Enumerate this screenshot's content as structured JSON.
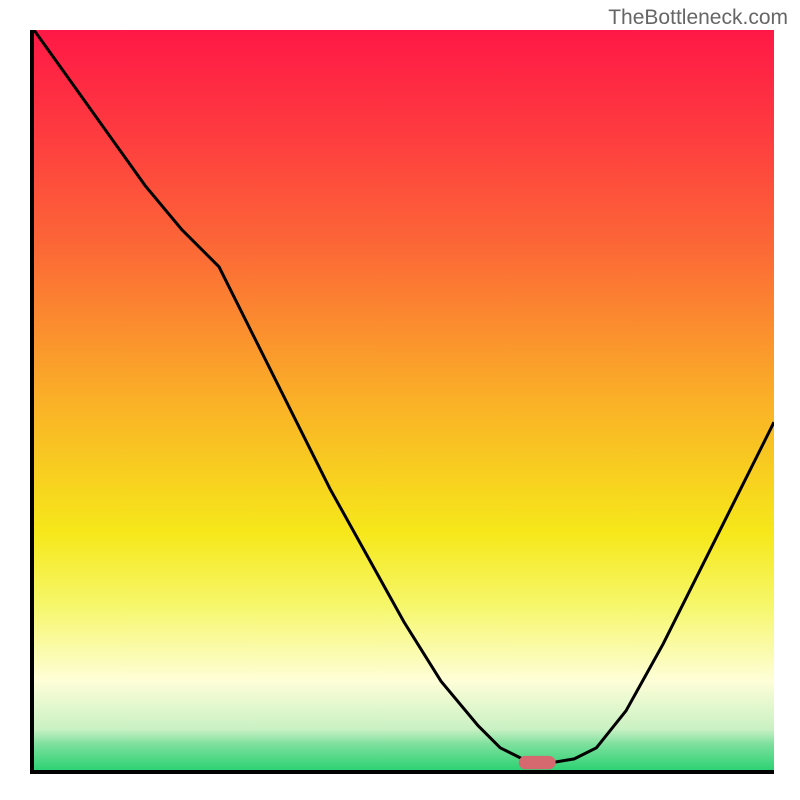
{
  "attribution": "TheBottleneck.com",
  "chart_data": {
    "type": "line",
    "title": "",
    "xlabel": "",
    "ylabel": "",
    "xlim": [
      0,
      100
    ],
    "ylim": [
      0,
      100
    ],
    "background_gradient": {
      "stops": [
        {
          "offset": 0.0,
          "color": "#ff1846"
        },
        {
          "offset": 0.15,
          "color": "#fe3e3f"
        },
        {
          "offset": 0.3,
          "color": "#fc6a36"
        },
        {
          "offset": 0.5,
          "color": "#fab027"
        },
        {
          "offset": 0.68,
          "color": "#f6e81a"
        },
        {
          "offset": 0.78,
          "color": "#f6f76d"
        },
        {
          "offset": 0.88,
          "color": "#fefed8"
        },
        {
          "offset": 0.945,
          "color": "#c9f1c3"
        },
        {
          "offset": 0.965,
          "color": "#7de09d"
        },
        {
          "offset": 1.0,
          "color": "#2dd274"
        }
      ]
    },
    "series": [
      {
        "name": "bottleneck-curve",
        "color": "#000000",
        "x": [
          0,
          5,
          10,
          15,
          20,
          25,
          30,
          35,
          40,
          45,
          50,
          55,
          60,
          63,
          66,
          70,
          73,
          76,
          80,
          85,
          90,
          95,
          100
        ],
        "y": [
          100,
          93,
          86,
          79,
          73,
          68,
          58,
          48,
          38,
          29,
          20,
          12,
          6,
          3,
          1.5,
          1,
          1.5,
          3,
          8,
          17,
          27,
          37,
          47
        ]
      }
    ],
    "marker": {
      "name": "target-marker",
      "x": 68,
      "y": 1,
      "width": 5.0,
      "height": 1.8,
      "color": "#d6696f"
    }
  }
}
